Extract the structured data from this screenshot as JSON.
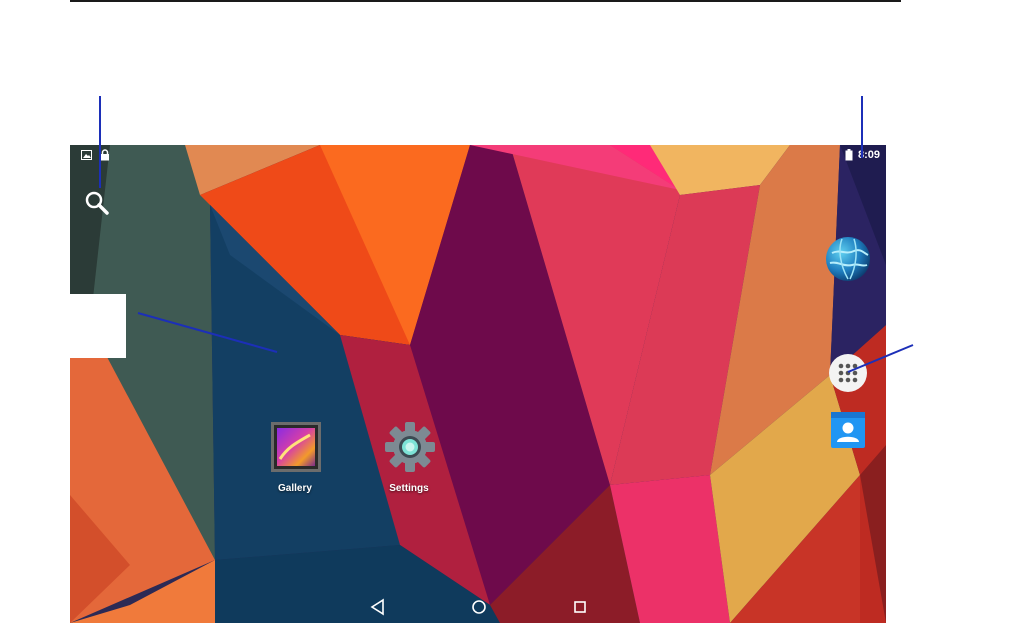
{
  "status_bar": {
    "time": "8:09",
    "left_icons": [
      "picture-notification-icon",
      "lock-icon"
    ],
    "right_icons": [
      "battery-icon"
    ]
  },
  "home": {
    "search_icon": "search-icon",
    "apps": [
      {
        "label": "Gallery",
        "icon": "gallery-icon"
      },
      {
        "label": "Settings",
        "icon": "settings-gear-icon"
      }
    ],
    "dock": [
      "browser-globe-icon",
      "app-drawer-icon",
      "contacts-icon"
    ]
  },
  "nav_bar": {
    "buttons": [
      "back-icon",
      "home-icon",
      "recents-icon"
    ]
  },
  "colors": {
    "annotation_line": "#1c2fb8",
    "status_text": "#ffffff"
  }
}
